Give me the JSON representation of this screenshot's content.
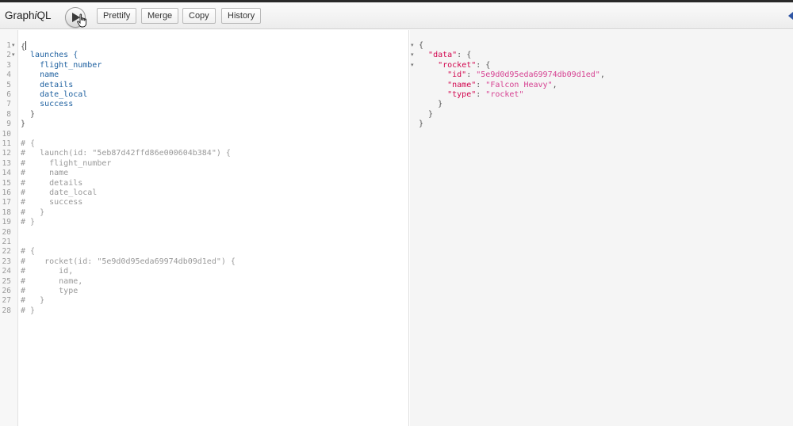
{
  "app": {
    "logo_prefix": "Graph",
    "logo_i": "i",
    "logo_suffix": "QL"
  },
  "toolbar": {
    "prettify_label": "Prettify",
    "merge_label": "Merge",
    "copy_label": "Copy",
    "history_label": "History"
  },
  "query_lines": [
    {
      "n": "1",
      "fold": "▾",
      "text": "{"
    },
    {
      "n": "2",
      "fold": "▾",
      "text": "  launches {"
    },
    {
      "n": "3",
      "fold": "",
      "text": "    flight_number"
    },
    {
      "n": "4",
      "fold": "",
      "text": "    name"
    },
    {
      "n": "5",
      "fold": "",
      "text": "    details"
    },
    {
      "n": "6",
      "fold": "",
      "text": "    date_local"
    },
    {
      "n": "7",
      "fold": "",
      "text": "    success"
    },
    {
      "n": "8",
      "fold": "",
      "text": "  }"
    },
    {
      "n": "9",
      "fold": "",
      "text": "}"
    },
    {
      "n": "10",
      "fold": "",
      "text": ""
    },
    {
      "n": "11",
      "fold": "",
      "text": "# {"
    },
    {
      "n": "12",
      "fold": "",
      "text": "#   launch(id: \"5eb87d42ffd86e000604b384\") {"
    },
    {
      "n": "13",
      "fold": "",
      "text": "#     flight_number"
    },
    {
      "n": "14",
      "fold": "",
      "text": "#     name"
    },
    {
      "n": "15",
      "fold": "",
      "text": "#     details"
    },
    {
      "n": "16",
      "fold": "",
      "text": "#     date_local"
    },
    {
      "n": "17",
      "fold": "",
      "text": "#     success"
    },
    {
      "n": "18",
      "fold": "",
      "text": "#   }"
    },
    {
      "n": "19",
      "fold": "",
      "text": "# }"
    },
    {
      "n": "20",
      "fold": "",
      "text": ""
    },
    {
      "n": "21",
      "fold": "",
      "text": ""
    },
    {
      "n": "22",
      "fold": "",
      "text": "# {"
    },
    {
      "n": "23",
      "fold": "",
      "text": "#    rocket(id: \"5e9d0d95eda69974db09d1ed\") {"
    },
    {
      "n": "24",
      "fold": "",
      "text": "#       id,"
    },
    {
      "n": "25",
      "fold": "",
      "text": "#       name,"
    },
    {
      "n": "26",
      "fold": "",
      "text": "#       type"
    },
    {
      "n": "27",
      "fold": "",
      "text": "#   }"
    },
    {
      "n": "28",
      "fold": "",
      "text": "# }"
    }
  ],
  "result_lines": [
    {
      "fold": "▾",
      "parts": [
        [
          "p",
          "{"
        ]
      ]
    },
    {
      "fold": "▾",
      "parts": [
        [
          "p",
          "  "
        ],
        [
          "k",
          "\"data\""
        ],
        [
          "p",
          ": {"
        ]
      ]
    },
    {
      "fold": "▾",
      "parts": [
        [
          "p",
          "    "
        ],
        [
          "k",
          "\"rocket\""
        ],
        [
          "p",
          ": {"
        ]
      ]
    },
    {
      "fold": "",
      "parts": [
        [
          "p",
          "      "
        ],
        [
          "k",
          "\"id\""
        ],
        [
          "p",
          ": "
        ],
        [
          "s",
          "\"5e9d0d95eda69974db09d1ed\""
        ],
        [
          "p",
          ","
        ]
      ]
    },
    {
      "fold": "",
      "parts": [
        [
          "p",
          "      "
        ],
        [
          "k",
          "\"name\""
        ],
        [
          "p",
          ": "
        ],
        [
          "s",
          "\"Falcon Heavy\""
        ],
        [
          "p",
          ","
        ]
      ]
    },
    {
      "fold": "",
      "parts": [
        [
          "p",
          "      "
        ],
        [
          "k",
          "\"type\""
        ],
        [
          "p",
          ": "
        ],
        [
          "s",
          "\"rocket\""
        ]
      ]
    },
    {
      "fold": "",
      "parts": [
        [
          "p",
          "    }"
        ]
      ]
    },
    {
      "fold": "",
      "parts": [
        [
          "p",
          "  }"
        ]
      ]
    },
    {
      "fold": "",
      "parts": [
        [
          "p",
          "}"
        ]
      ]
    }
  ],
  "colors": {
    "field": "#1f61a0",
    "comment": "#999999",
    "json_key": "#d2054e",
    "json_string": "#d64292"
  }
}
